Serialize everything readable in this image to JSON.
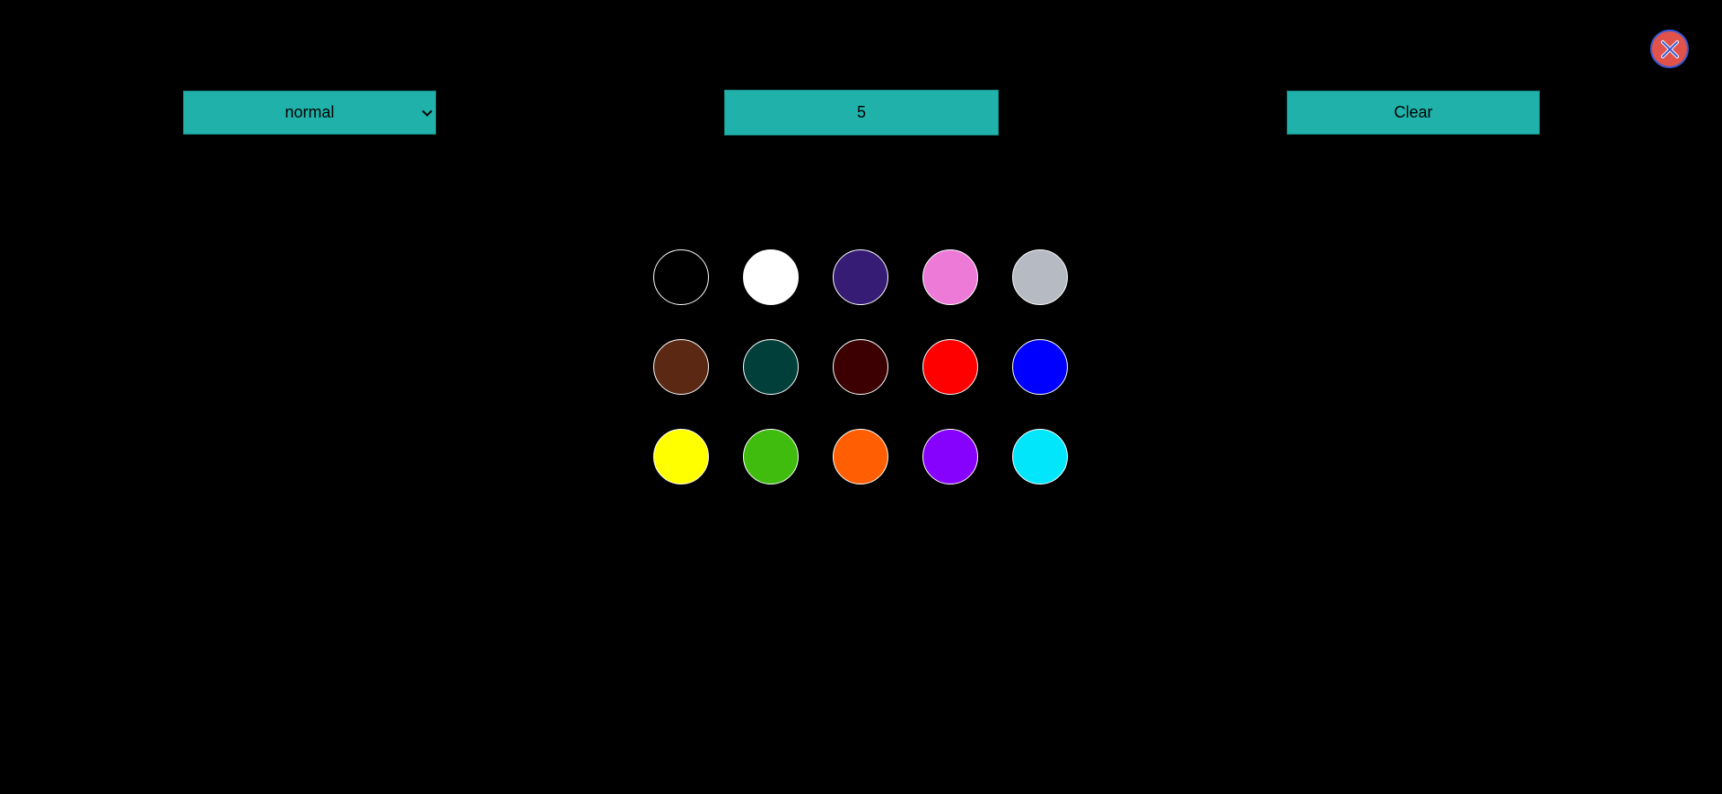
{
  "toolbar": {
    "mode_select": {
      "value": "normal",
      "options": [
        "normal"
      ]
    },
    "brush_size": "5",
    "clear_label": "Clear"
  },
  "close_button": {
    "icon": "close-icon",
    "fill_color": "#e0524a",
    "ring_color": "#3b5bd6"
  },
  "accent_color": "#20b2aa",
  "palette": [
    {
      "name": "black",
      "color": "#000000"
    },
    {
      "name": "white",
      "color": "#ffffff"
    },
    {
      "name": "dark-purple",
      "color": "#371c76"
    },
    {
      "name": "pink",
      "color": "#ee7ad8"
    },
    {
      "name": "light-gray",
      "color": "#b5bac3"
    },
    {
      "name": "brown",
      "color": "#5b2814"
    },
    {
      "name": "dark-teal",
      "color": "#003f3a"
    },
    {
      "name": "dark-maroon",
      "color": "#3c0002"
    },
    {
      "name": "red",
      "color": "#ff0000"
    },
    {
      "name": "blue",
      "color": "#0000ff"
    },
    {
      "name": "yellow",
      "color": "#ffff00"
    },
    {
      "name": "green",
      "color": "#3fbc0e"
    },
    {
      "name": "orange",
      "color": "#ff5e03"
    },
    {
      "name": "violet",
      "color": "#8702fc"
    },
    {
      "name": "cyan",
      "color": "#02e6fb"
    }
  ]
}
